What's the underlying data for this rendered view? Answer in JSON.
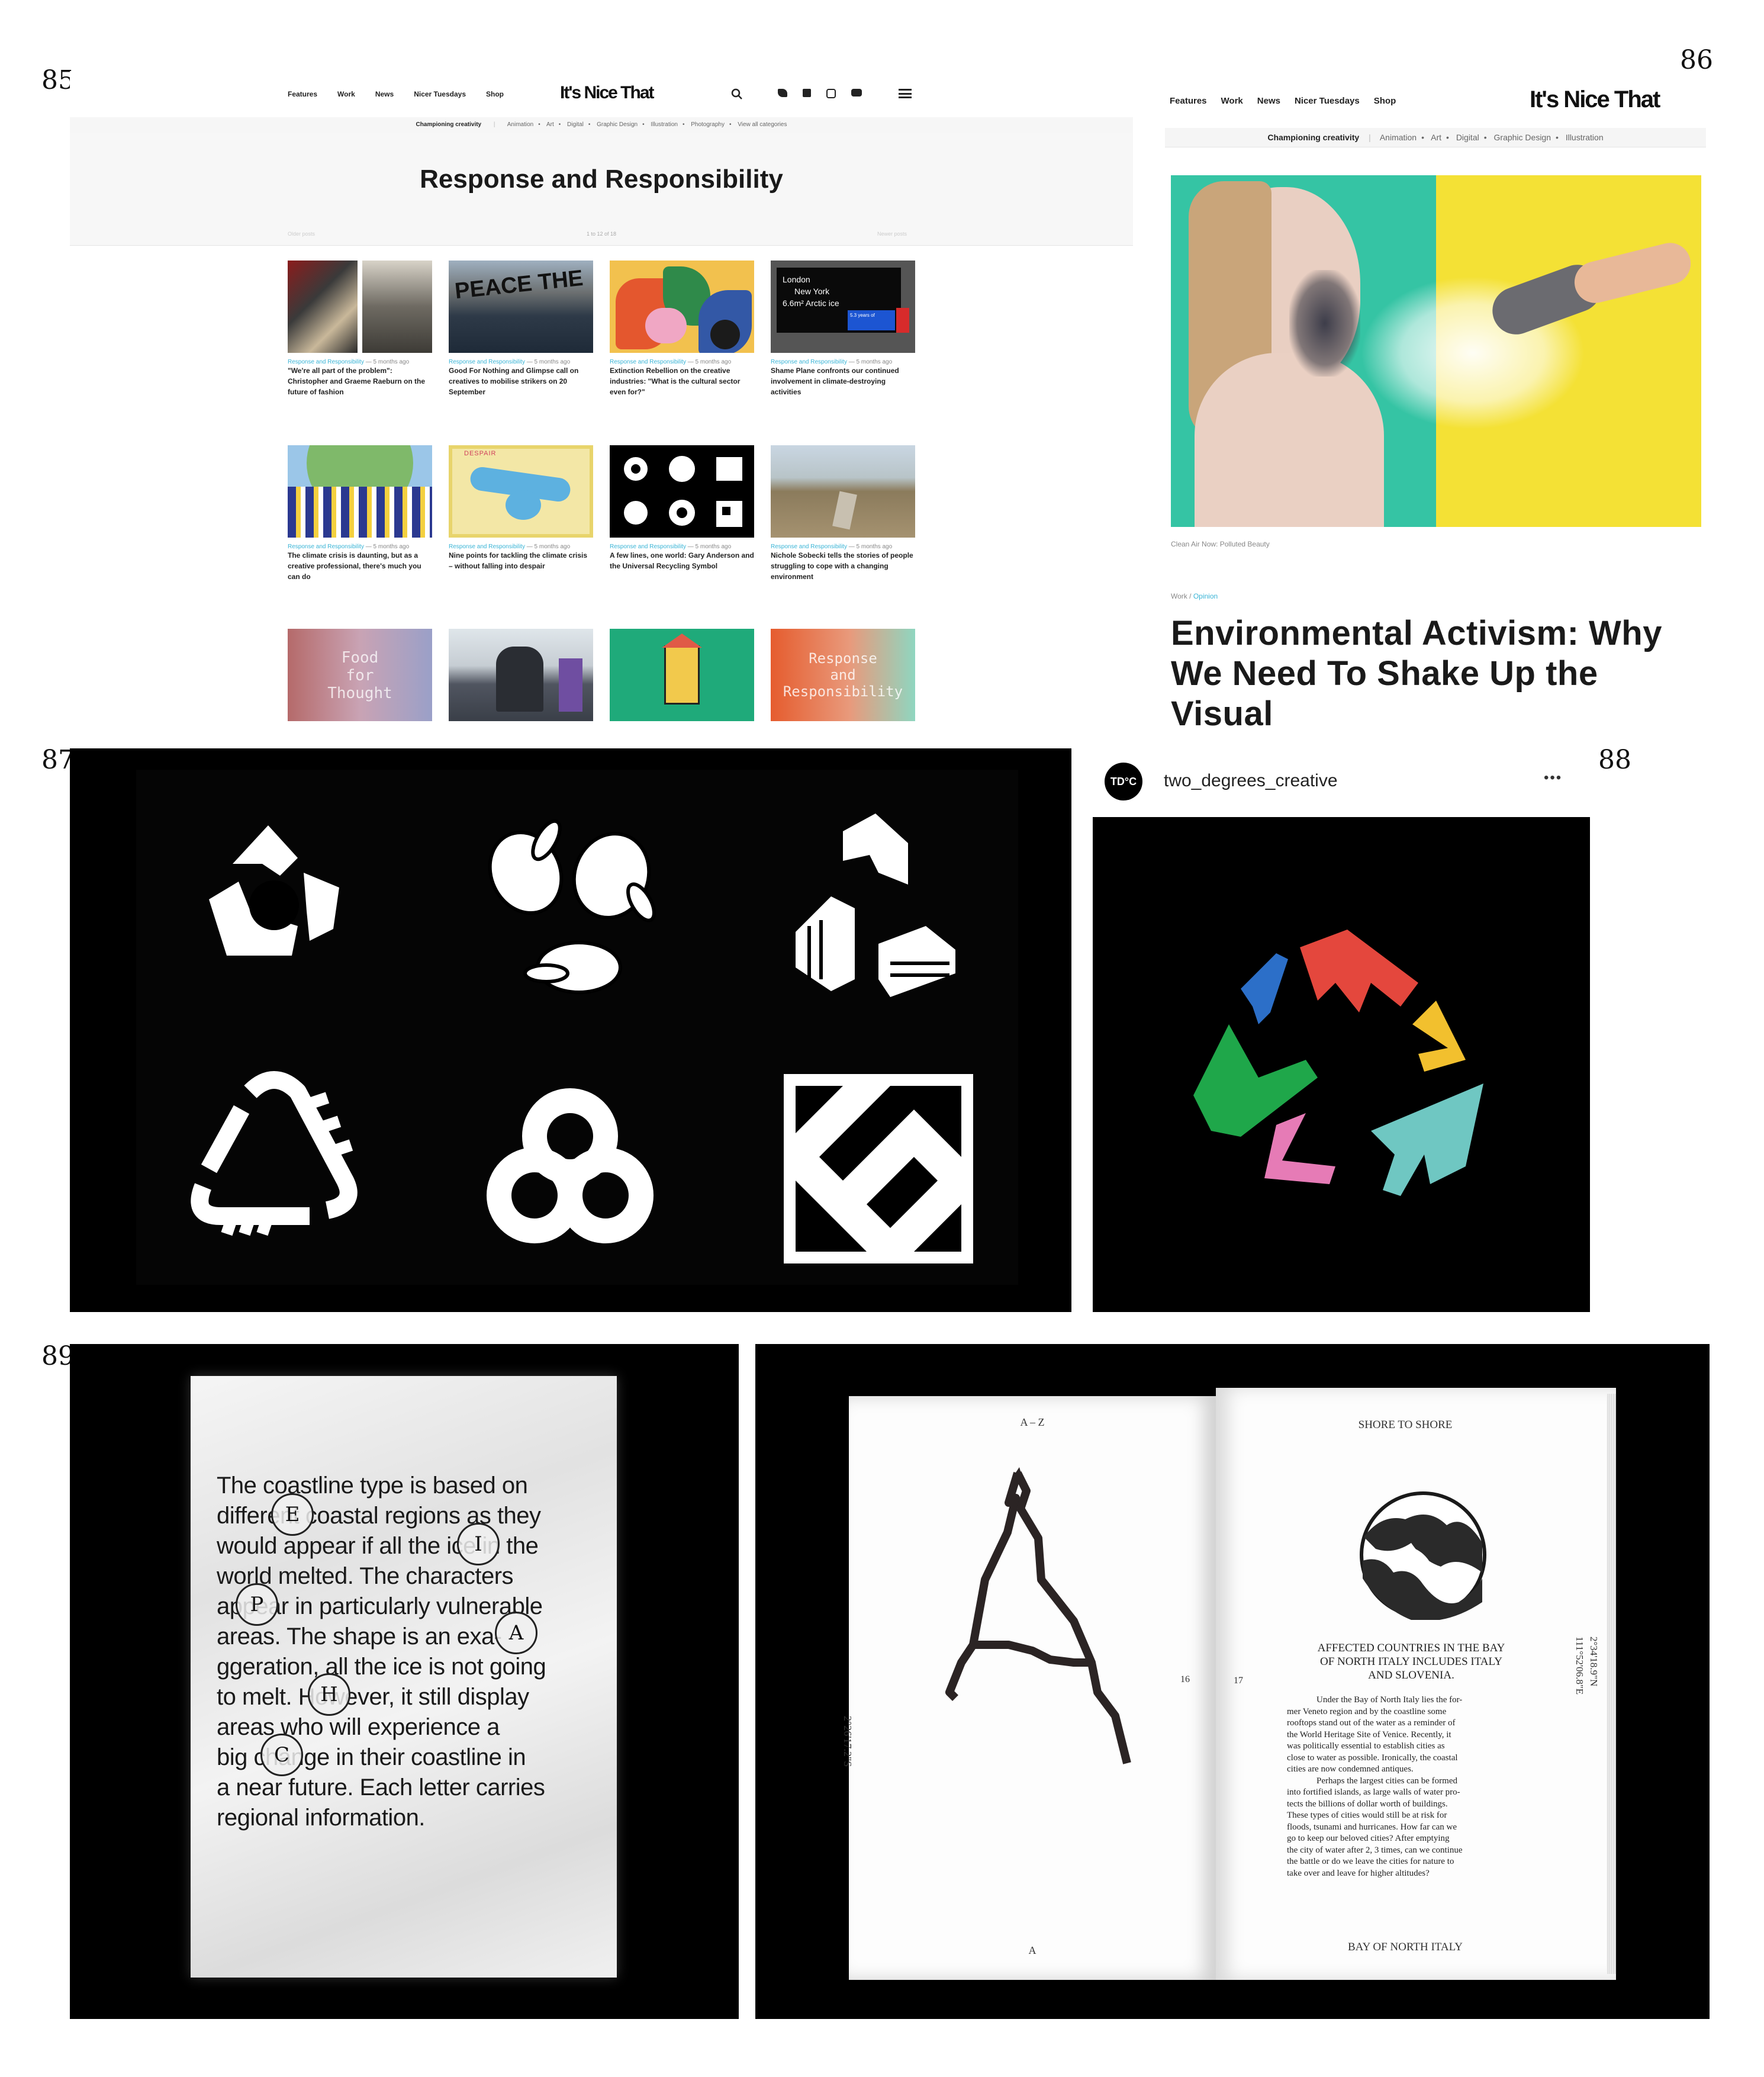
{
  "figure_numbers": {
    "f85": "85",
    "f86": "86",
    "f87": "87",
    "f88": "88",
    "f89": "89"
  },
  "inc_85": {
    "nav": [
      "Features",
      "Work",
      "News",
      "Nicer Tuesdays",
      "Shop"
    ],
    "logo": "It's Nice That",
    "subnav_lead": "Championing creativity",
    "subnav_items": [
      "Animation",
      "Art",
      "Digital",
      "Graphic Design",
      "Illustration",
      "Photography",
      "View all categories"
    ],
    "page_title": "Response and Responsibility",
    "pager": {
      "older": "Older posts",
      "count": "1 to 12 of 18",
      "newer": "Newer posts"
    },
    "cards": [
      {
        "meta": "Response and Responsibility",
        "age": "— 5 months ago",
        "title": "\"We're all part of the problem\": Christopher and Graeme Raeburn on the future of fashion"
      },
      {
        "meta": "Response and Responsibility",
        "age": "— 5 months ago",
        "title": "Good For Nothing and Glimpse call on creatives to mobilise strikers on 20 September"
      },
      {
        "meta": "Response and Responsibility",
        "age": "— 5 months ago",
        "title": "Extinction Rebellion on the creative industries: \"What is the cultural sector even for?\""
      },
      {
        "meta": "Response and Responsibility",
        "age": "— 5 months ago",
        "title": "Shame Plane confronts our continued involvement in climate-destroying activities"
      },
      {
        "meta": "Response and Responsibility",
        "age": "— 5 months ago",
        "title": "The climate crisis is daunting, but as a creative professional, there's much you can do"
      },
      {
        "meta": "Response and Responsibility",
        "age": "— 5 months ago",
        "title": "Nine points for tackling the climate crisis – without falling into despair"
      },
      {
        "meta": "Response and Responsibility",
        "age": "— 5 months ago",
        "title": "A few lines, one world: Gary Anderson and the Universal Recycling Symbol"
      },
      {
        "meta": "Response and Responsibility",
        "age": "— 5 months ago",
        "title": "Nichole Sobecki tells the stories of people struggling to cope with a changing environment"
      }
    ],
    "shame_plane": {
      "city1": "London",
      "city2": "New York",
      "stat": "6.6m² Arctic ice",
      "note": "5.3 years of"
    },
    "despair_label": "DESPAIR",
    "food_thought": [
      "Food",
      "for",
      "Thought"
    ],
    "response_tile": [
      "Response",
      "and",
      "Responsibility"
    ]
  },
  "inc_86": {
    "nav": [
      "Features",
      "Work",
      "News",
      "Nicer Tuesdays",
      "Shop"
    ],
    "logo": "It's Nice That",
    "subnav_lead": "Championing creativity",
    "subnav_items": [
      "Animation",
      "Art",
      "Digital",
      "Graphic Design",
      "Illustration"
    ],
    "caption": "Clean Air Now: Polluted Beauty",
    "crumb_work": "Work",
    "crumb_sep": "/",
    "crumb_opinion": "Opinion",
    "headline_lines": [
      "Environmental Activism: Why",
      "We Need To Shake Up the",
      "Visual"
    ]
  },
  "insta_88": {
    "avatar": "TD°C",
    "handle": "two_degrees_creative",
    "more": "•••"
  },
  "paper_89": {
    "lines": [
      "The coastline type is based on",
      "different coastal regions as they",
      "would appear if all the ice in the",
      "world melted. The characters",
      "appear in particularly vulnerable",
      "areas. The shape is an exa-",
      "ggeration, all the ice is not going",
      "to melt. However, it still display",
      "areas who will experience a",
      "big change in their coastline in",
      "a near future. Each letter carries",
      "regional information."
    ],
    "stamps": [
      "E",
      "I",
      "P",
      "A",
      "H",
      "C"
    ]
  },
  "book": {
    "left_header": "A – Z",
    "left_coord": "2°26'17.2\"S",
    "left_footer": "A",
    "left_page": "16",
    "right_page": "17",
    "right_header": "SHORE TO SHORE",
    "right_coord1": "111°52'06.8\"E",
    "right_coord2": "2°34'18.9\"N",
    "heading_lines": [
      "AFFECTED COUNTRIES IN THE BAY",
      "OF NORTH ITALY INCLUDES ITALY",
      "AND SLOVENIA."
    ],
    "body_lines": [
      "Under the Bay of North Italy lies the for-",
      "mer Veneto region and by the coastline some",
      "rooftops stand out of the water as a reminder of",
      "the World Heritage Site of Venice. Recently, it",
      "was politically essential to establish cities as",
      "close to water as possible. Ironically, the coastal",
      "cities are now condemned antiques.",
      "Perhaps the largest cities can be formed",
      "into fortified islands, as large walls of water pro-",
      "tects the billions of dollar worth of buildings.",
      "These types of cities would still be at risk for",
      "floods, tsunami and hurricanes. How far can we",
      "go to keep our beloved cities? After emptying",
      "the city of water after 2, 3 times, can we continue",
      "the battle or do we leave the cities for nature to",
      "take over and leave for higher altitudes?"
    ],
    "right_footer": "BAY OF NORTH ITALY"
  }
}
